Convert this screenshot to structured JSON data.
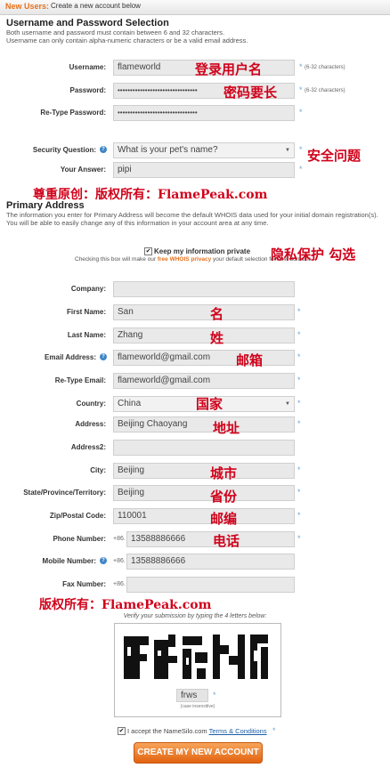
{
  "header": {
    "new_users": "New Users:",
    "subtitle": "Create a new account below"
  },
  "credentials": {
    "title": "Username and Password Selection",
    "desc1": "Both username and password must contain between 6 and 32 characters.",
    "desc2": "Username can only contain alpha-numeric characters or be a valid email address.",
    "username_label": "Username:",
    "username_value": "flameworld",
    "password_label": "Password:",
    "password_value": "••••••••••••••••••••••••••••••••",
    "retype_label": "Re-Type Password:",
    "retype_value": "••••••••••••••••••••••••••••••••",
    "length_hint": "(6-32 characters)",
    "security_label": "Security Question:",
    "security_value": "What is your pet's name?",
    "answer_label": "Your Answer:",
    "answer_value": "pipi"
  },
  "annotations": {
    "login_user": "登录用户名",
    "password_len": "密码要长",
    "security": "安全问题",
    "copyright1": "尊重原创：版权所有：FlamePeak.com",
    "privacy": "隐私保护  勾选",
    "name": "名",
    "surname": "姓",
    "email": "邮箱",
    "country": "国家",
    "address": "地址",
    "city": "城市",
    "province": "省份",
    "zip": "邮编",
    "phone": "电话",
    "copyright2": "版权所有：FlamePeak.com"
  },
  "primary": {
    "title": "Primary Address",
    "desc1": "The information you enter for Primary Address will become the default WHOIS data used for your initial domain registration(s).",
    "desc2": "You will be able to easily change any of this information in your account area at any time.",
    "privacy_label": "Keep my information private",
    "privacy_note_pre": "Checking this box will make our ",
    "privacy_link": "free WHOIS privacy",
    "privacy_note_post": " your default selection for new domains",
    "company_label": "Company:",
    "company_value": "",
    "first_label": "First Name:",
    "first_value": "San",
    "last_label": "Last Name:",
    "last_value": "Zhang",
    "email_label": "Email Address:",
    "email_value": "flameworld@gmail.com",
    "reemail_label": "Re-Type Email:",
    "reemail_value": "flameworld@gmail.com",
    "country_label": "Country:",
    "country_value": "China",
    "address_label": "Address:",
    "address_value": "Beijing Chaoyang",
    "address2_label": "Address2:",
    "address2_value": "",
    "city_label": "City:",
    "city_value": "Beijing",
    "state_label": "State/Province/Territory:",
    "state_value": "Beijing",
    "zip_label": "Zip/Postal Code:",
    "zip_value": "110001",
    "phone_label": "Phone Number:",
    "phone_prefix": "+86.",
    "phone_value": "13588886666",
    "mobile_label": "Mobile Number:",
    "mobile_prefix": "+86.",
    "mobile_value": "13588886666",
    "fax_label": "Fax Number:",
    "fax_prefix": "+86.",
    "fax_value": ""
  },
  "captcha": {
    "verify_text": "Verify your submission by typing the 4 letters below:",
    "value": "frws",
    "case_note": "(case insensitive)"
  },
  "terms": {
    "pre": "I accept the NameSilo.com ",
    "link": "Terms & Conditions"
  },
  "submit_label": "CREATE MY NEW ACCOUNT"
}
